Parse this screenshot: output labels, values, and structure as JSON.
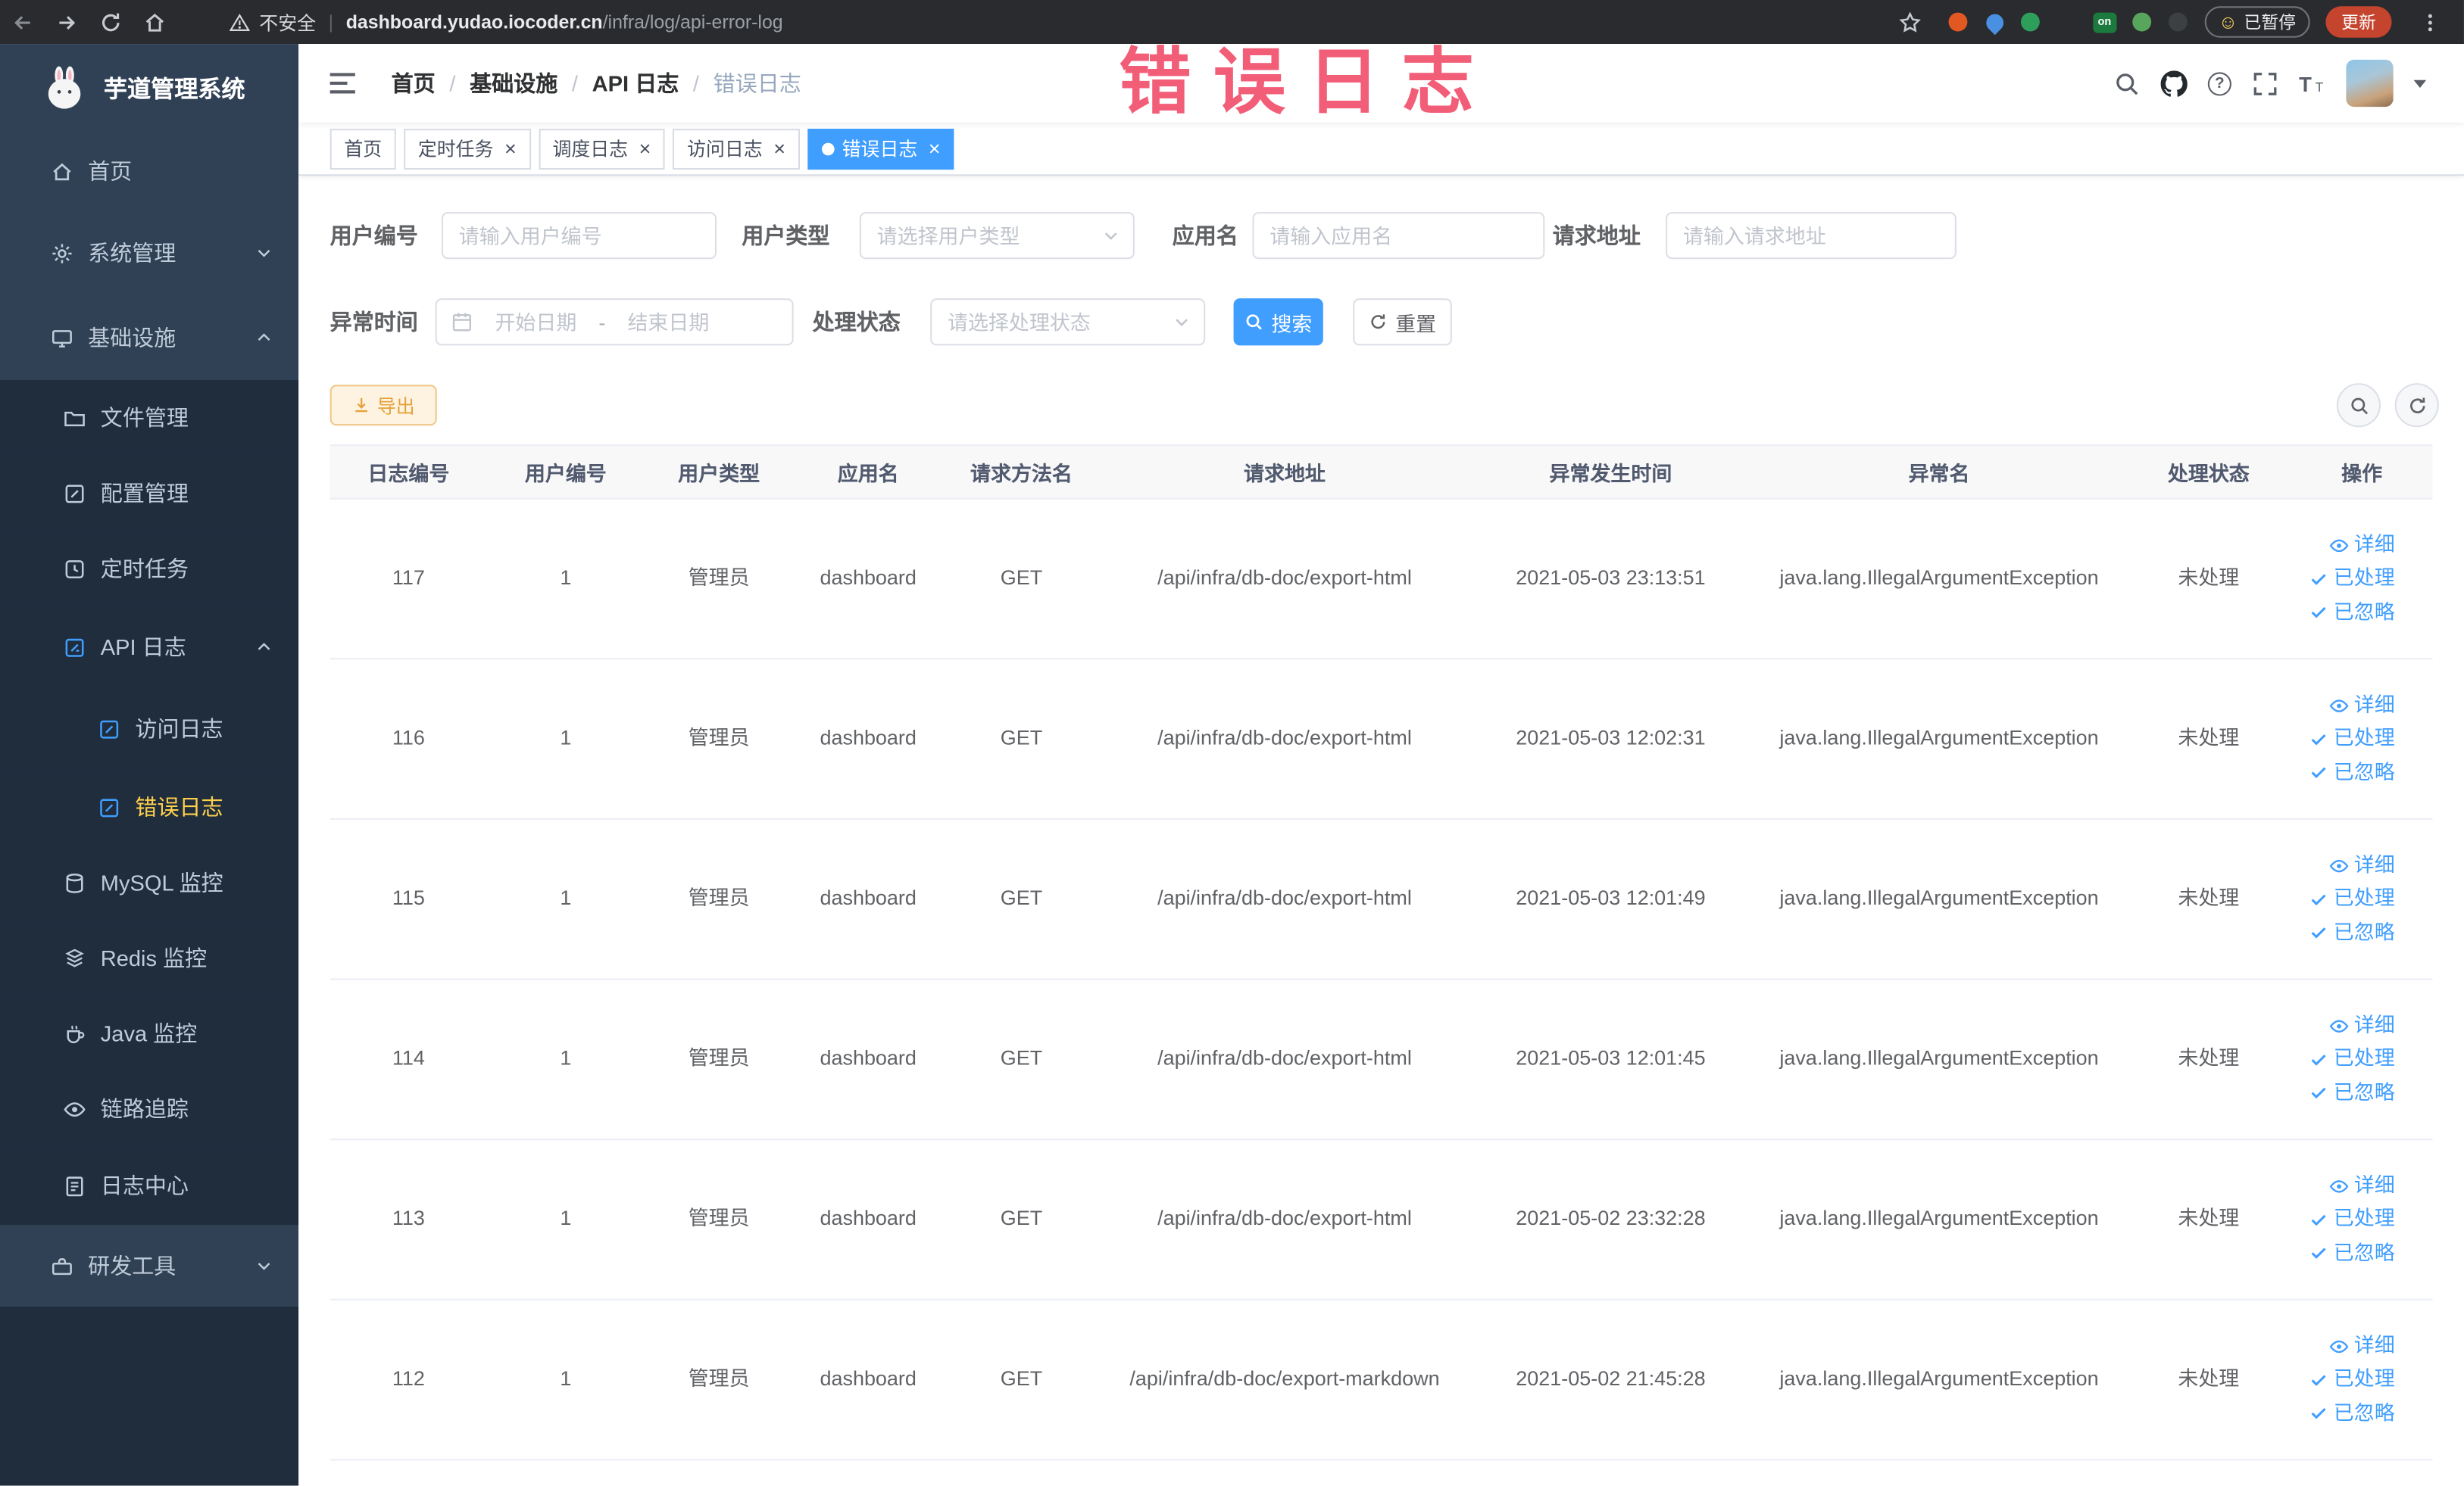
{
  "browser": {
    "security_label": "不安全",
    "url_domain": "dashboard.yudao.iocoder.cn",
    "url_path": "/infra/log/api-error-log",
    "ext_on_label": "on",
    "paused_label": "已暂停",
    "update_label": "更新"
  },
  "icons": {
    "close": "×",
    "smiley": "☺",
    "question": "?"
  },
  "annotation": {
    "text": "错误日志"
  },
  "sidebar": {
    "logo": "芋道管理系统",
    "home": "首页",
    "system": "系统管理",
    "infra": "基础设施",
    "file": "文件管理",
    "config": "配置管理",
    "job": "定时任务",
    "apilog": "API 日志",
    "accesslog": "访问日志",
    "errorlog": "错误日志",
    "mysql": "MySQL 监控",
    "redis": "Redis 监控",
    "java": "Java 监控",
    "trace": "链路追踪",
    "logcenter": "日志中心",
    "devtools": "研发工具"
  },
  "navbar": {
    "breadcrumb": [
      "首页",
      "基础设施",
      "API 日志",
      "错误日志"
    ]
  },
  "tags": [
    {
      "label": "首页"
    },
    {
      "label": "定时任务"
    },
    {
      "label": "调度日志"
    },
    {
      "label": "访问日志"
    },
    {
      "label": "错误日志"
    }
  ],
  "filters": {
    "user_id": {
      "label": "用户编号",
      "placeholder": "请输入用户编号"
    },
    "user_type": {
      "label": "用户类型",
      "placeholder": "请选择用户类型"
    },
    "app_name": {
      "label": "应用名",
      "placeholder": "请输入应用名"
    },
    "request_url": {
      "label": "请求地址",
      "placeholder": "请输入请求地址"
    },
    "exception_time": {
      "label": "异常时间",
      "start_placeholder": "开始日期",
      "end_placeholder": "结束日期",
      "separator": "-"
    },
    "process_status": {
      "label": "处理状态",
      "placeholder": "请选择处理状态"
    },
    "search_label": "搜索",
    "reset_label": "重置"
  },
  "toolbar": {
    "export_label": "导出"
  },
  "table": {
    "columns": [
      "日志编号",
      "用户编号",
      "用户类型",
      "应用名",
      "请求方法名",
      "请求地址",
      "异常发生时间",
      "异常名",
      "处理状态",
      "操作"
    ],
    "action_detail": "详细",
    "action_processed": "已处理",
    "action_ignored": "已忽略",
    "rows": [
      {
        "id": "117",
        "user_id": "1",
        "user_type": "管理员",
        "app": "dashboard",
        "method": "GET",
        "url": "/api/infra/db-doc/export-html",
        "time": "2021-05-03 23:13:51",
        "exception": "java.lang.IllegalArgumentException",
        "status": "未处理"
      },
      {
        "id": "116",
        "user_id": "1",
        "user_type": "管理员",
        "app": "dashboard",
        "method": "GET",
        "url": "/api/infra/db-doc/export-html",
        "time": "2021-05-03 12:02:31",
        "exception": "java.lang.IllegalArgumentException",
        "status": "未处理"
      },
      {
        "id": "115",
        "user_id": "1",
        "user_type": "管理员",
        "app": "dashboard",
        "method": "GET",
        "url": "/api/infra/db-doc/export-html",
        "time": "2021-05-03 12:01:49",
        "exception": "java.lang.IllegalArgumentException",
        "status": "未处理"
      },
      {
        "id": "114",
        "user_id": "1",
        "user_type": "管理员",
        "app": "dashboard",
        "method": "GET",
        "url": "/api/infra/db-doc/export-html",
        "time": "2021-05-03 12:01:45",
        "exception": "java.lang.IllegalArgumentException",
        "status": "未处理"
      },
      {
        "id": "113",
        "user_id": "1",
        "user_type": "管理员",
        "app": "dashboard",
        "method": "GET",
        "url": "/api/infra/db-doc/export-html",
        "time": "2021-05-02 23:32:28",
        "exception": "java.lang.IllegalArgumentException",
        "status": "未处理"
      },
      {
        "id": "112",
        "user_id": "1",
        "user_type": "管理员",
        "app": "dashboard",
        "method": "GET",
        "url": "/api/infra/db-doc/export-markdown",
        "time": "2021-05-02 21:45:28",
        "exception": "java.lang.IllegalArgumentException",
        "status": "未处理"
      }
    ]
  }
}
